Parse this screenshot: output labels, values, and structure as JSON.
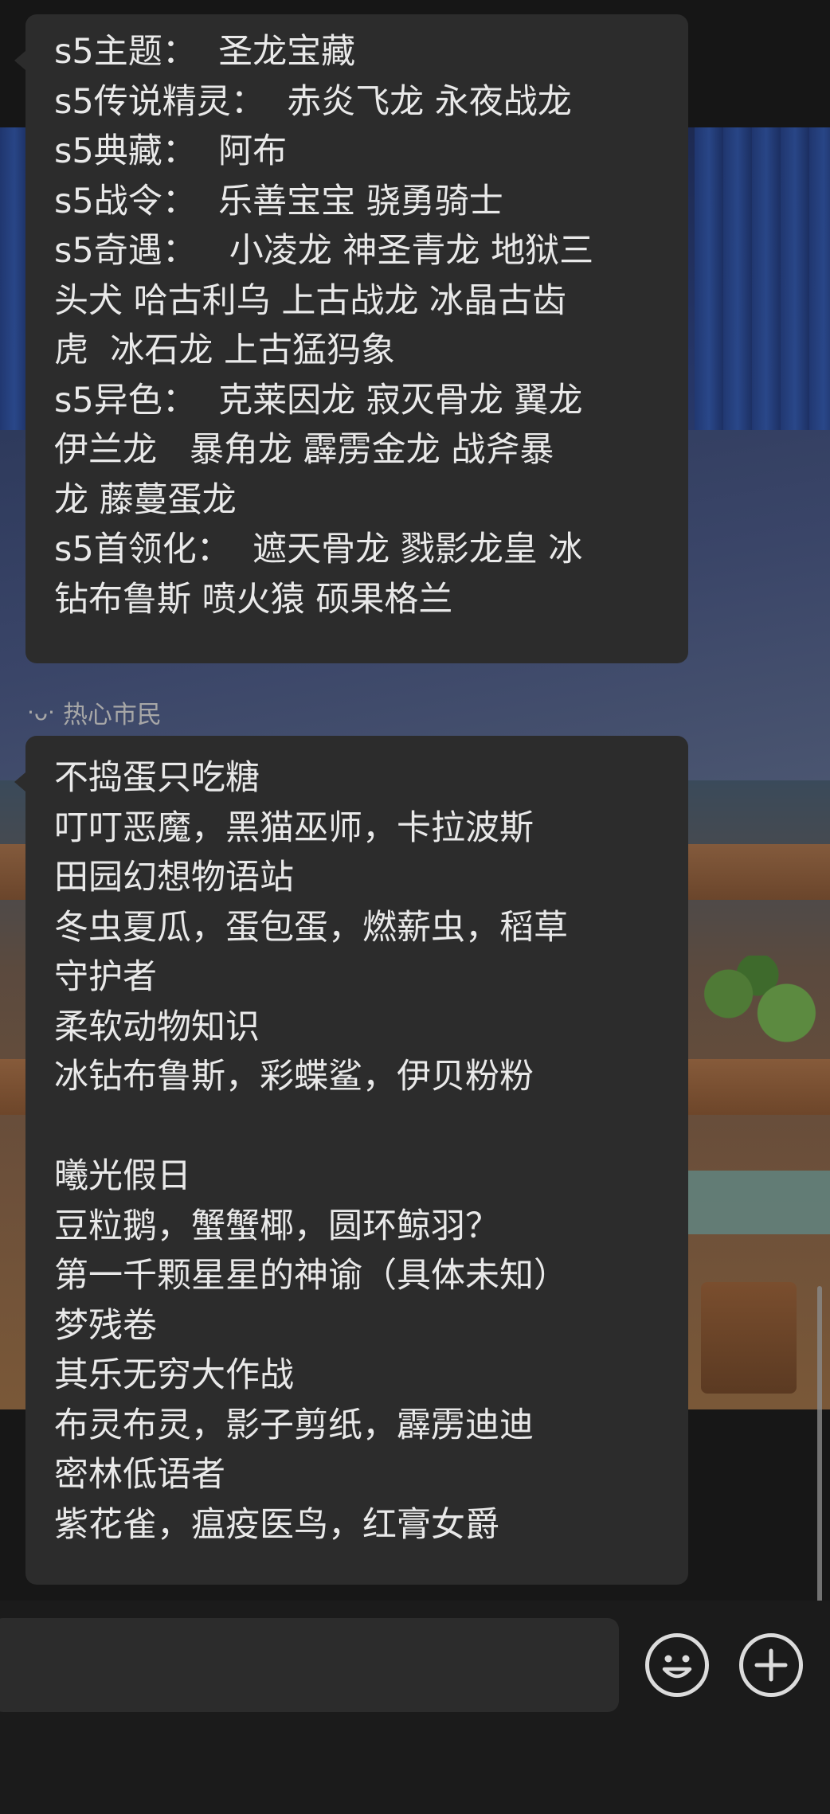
{
  "chat": {
    "messages": [
      {
        "lines": [
          "s5主题：  圣龙宝藏",
          "s5传说精灵：  赤炎飞龙 永夜战龙",
          "s5典藏：  阿布",
          "s5战令：  乐善宝宝 骁勇骑士",
          "s5奇遇：   小凌龙 神圣青龙 地狱三",
          "头犬 哈古利乌 上古战龙 冰晶古齿",
          "虎  冰石龙 上古猛犸象",
          "s5异色：  克莱因龙 寂灭骨龙 翼龙",
          "伊兰龙   暴角龙 霹雳金龙 战斧暴",
          "龙 藤蔓蛋龙",
          "s5首领化：  遮天骨龙 戮影龙皇 冰",
          "钻布鲁斯 喷火猿 硕果格兰"
        ]
      },
      {
        "sender": "热心市民",
        "sender_prefix": "·ᴗ·",
        "lines": [
          "不捣蛋只吃糖",
          "叮叮恶魔，黑猫巫师，卡拉波斯",
          "田园幻想物语站",
          "冬虫夏瓜，蛋包蛋，燃薪虫，稻草",
          "守护者",
          "柔软动物知识",
          "冰钻布鲁斯，彩蝶鲨，伊贝粉粉",
          "",
          "曦光假日",
          "豆粒鹅，蟹蟹椰，圆环鲸羽？",
          "第一千颗星星的神谕（具体未知）",
          "梦残卷",
          "其乐无穷大作战",
          "布灵布灵，影子剪纸，霹雳迪迪",
          "密林低语者",
          "紫花雀，瘟疫医鸟，红膏女爵"
        ]
      }
    ]
  },
  "input": {
    "value": "",
    "placeholder": ""
  },
  "icons": {
    "emoji": "smiley-icon",
    "add": "plus-icon"
  },
  "colors": {
    "bubble": "#2c2c2c",
    "text": "#e9e9e9",
    "sender": "#a7a7a7"
  }
}
